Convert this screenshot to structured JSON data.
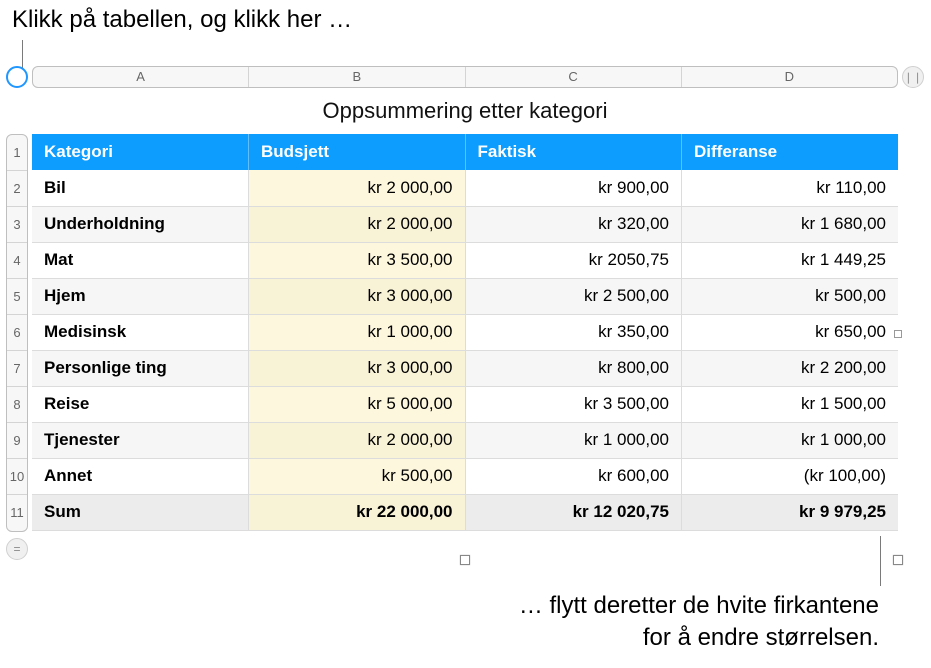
{
  "callouts": {
    "top": "Klikk på tabellen, og klikk her …",
    "bottom_l1": "… flytt deretter de hvite firkantene",
    "bottom_l2": "for å endre størrelsen."
  },
  "columns": {
    "a": "A",
    "b": "B",
    "c": "C",
    "d": "D"
  },
  "rows": {
    "r1": "1",
    "r2": "2",
    "r3": "3",
    "r4": "4",
    "r5": "5",
    "r6": "6",
    "r7": "7",
    "r8": "8",
    "r9": "9",
    "r10": "10",
    "r11": "11"
  },
  "title": "Oppsummering etter kategori",
  "headers": {
    "cat": "Kategori",
    "bud": "Budsjett",
    "act": "Faktisk",
    "diff": "Differanse"
  },
  "data": [
    {
      "cat": "Bil",
      "bud": "kr 2 000,00",
      "act": "kr 900,00",
      "diff": "kr 110,00",
      "neg": false
    },
    {
      "cat": "Underholdning",
      "bud": "kr 2 000,00",
      "act": "kr 320,00",
      "diff": "kr 1 680,00",
      "neg": false
    },
    {
      "cat": "Mat",
      "bud": "kr 3 500,00",
      "act": "kr 2050,75",
      "diff": "kr 1 449,25",
      "neg": false
    },
    {
      "cat": "Hjem",
      "bud": "kr 3 000,00",
      "act": "kr 2 500,00",
      "diff": "kr 500,00",
      "neg": false
    },
    {
      "cat": "Medisinsk",
      "bud": "kr 1 000,00",
      "act": "kr 350,00",
      "diff": "kr 650,00",
      "neg": false
    },
    {
      "cat": "Personlige ting",
      "bud": "kr 3 000,00",
      "act": "kr 800,00",
      "diff": "kr 2 200,00",
      "neg": false
    },
    {
      "cat": "Reise",
      "bud": "kr 5 000,00",
      "act": "kr 3 500,00",
      "diff": "kr 1 500,00",
      "neg": false
    },
    {
      "cat": "Tjenester",
      "bud": "kr 2 000,00",
      "act": "kr 1 000,00",
      "diff": "kr 1 000,00",
      "neg": false
    },
    {
      "cat": "Annet",
      "bud": "kr 500,00",
      "act": "kr 600,00",
      "diff": "(kr 100,00)",
      "neg": true
    }
  ],
  "sum": {
    "cat": "Sum",
    "bud": "kr 22 000,00",
    "act": "kr 12 020,75",
    "diff": "kr 9 979,25"
  },
  "icons": {
    "cols": "❘❘",
    "rows": "="
  },
  "chart_data": {
    "type": "table",
    "title": "Oppsummering etter kategori",
    "columns": [
      "Kategori",
      "Budsjett",
      "Faktisk",
      "Differanse"
    ],
    "rows": [
      [
        "Bil",
        2000.0,
        900.0,
        110.0
      ],
      [
        "Underholdning",
        2000.0,
        320.0,
        1680.0
      ],
      [
        "Mat",
        3500.0,
        2050.75,
        1449.25
      ],
      [
        "Hjem",
        3000.0,
        2500.0,
        500.0
      ],
      [
        "Medisinsk",
        1000.0,
        350.0,
        650.0
      ],
      [
        "Personlige ting",
        3000.0,
        800.0,
        2200.0
      ],
      [
        "Reise",
        5000.0,
        3500.0,
        1500.0
      ],
      [
        "Tjenester",
        2000.0,
        1000.0,
        1000.0
      ],
      [
        "Annet",
        500.0,
        600.0,
        -100.0
      ]
    ],
    "totals": [
      "Sum",
      22000.0,
      12020.75,
      9979.25
    ],
    "currency": "kr"
  }
}
